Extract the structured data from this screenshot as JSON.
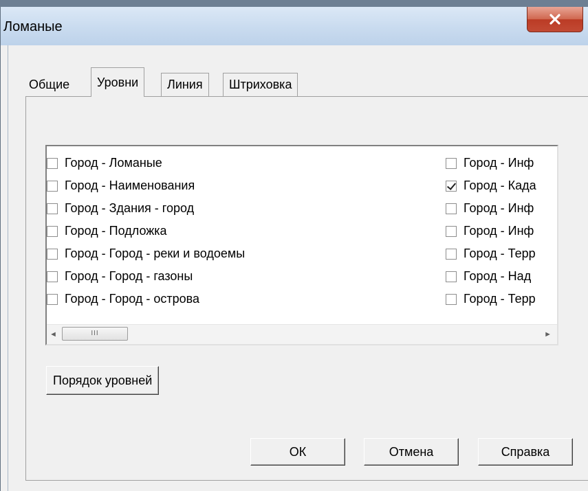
{
  "window": {
    "title": "Ломаные",
    "close_icon": "close-icon"
  },
  "tabs": [
    {
      "label": "Общие",
      "active": false
    },
    {
      "label": "Уровни",
      "active": true
    },
    {
      "label": "Линия",
      "active": false
    },
    {
      "label": "Штриховка",
      "active": false
    }
  ],
  "levels": {
    "left": [
      {
        "label": "Город - Ломаные",
        "checked": false
      },
      {
        "label": "Город - Наименования",
        "checked": false
      },
      {
        "label": "Город - Здания - город",
        "checked": false
      },
      {
        "label": "Город - Подложка",
        "checked": false
      },
      {
        "label": "Город - Город - реки и водоемы",
        "checked": false
      },
      {
        "label": "Город - Город - газоны",
        "checked": false
      },
      {
        "label": "Город - Город - острова",
        "checked": false
      }
    ],
    "right": [
      {
        "label": "Город - Инф",
        "checked": false
      },
      {
        "label": "Город - Када",
        "checked": true
      },
      {
        "label": "Город - Инф",
        "checked": false
      },
      {
        "label": "Город - Инф",
        "checked": false
      },
      {
        "label": "Город - Терр",
        "checked": false
      },
      {
        "label": "Город - Над",
        "checked": false
      },
      {
        "label": "Город - Терр",
        "checked": false
      }
    ]
  },
  "scrollbar": {
    "thumb_grip": "III",
    "left_arrow_icon": "scroll-left-arrow-icon",
    "right_arrow_icon": "scroll-right-arrow-icon"
  },
  "order_button": "Порядок уровней",
  "footer": {
    "ok": "ОК",
    "cancel": "Отмена",
    "help": "Справка"
  }
}
